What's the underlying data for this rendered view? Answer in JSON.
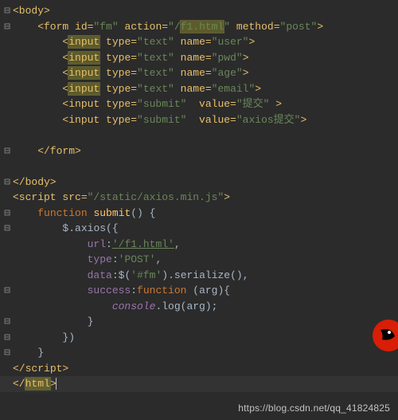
{
  "code": {
    "l1": "<body>",
    "l2a": "    <form id=",
    "l2b": "\"fm\"",
    "l2c": " action=",
    "l2d": "\"/",
    "l2e": "f1.html",
    "l2f": "\"",
    "l2g": " method=",
    "l2h": "\"post\"",
    "l2i": ">",
    "l3a": "        <",
    "l3b": "input",
    "l3c": " type=",
    "l3d": "\"text\"",
    "l3e": " name=",
    "l3f": "\"user\"",
    "l3g": ">",
    "l4a": "        <",
    "l4b": "input",
    "l4c": " type=",
    "l4d": "\"text\"",
    "l4e": " name=",
    "l4f": "\"pwd\"",
    "l4g": ">",
    "l5a": "        <",
    "l5b": "input",
    "l5c": " type=",
    "l5d": "\"text\"",
    "l5e": " name=",
    "l5f": "\"age\"",
    "l5g": ">",
    "l6a": "        <",
    "l6b": "input",
    "l6c": " type=",
    "l6d": "\"text\"",
    "l6e": " name=",
    "l6f": "\"email\"",
    "l6g": ">",
    "l7a": "        <input type=",
    "l7b": "\"submit\"",
    "l7c": "  value=",
    "l7d": "\"提交\"",
    "l7e": " >",
    "l8a": "        <input type=",
    "l8b": "\"submit\"",
    "l8c": "  value=",
    "l8d": "\"axios提交\"",
    "l8e": ">",
    "l9": "",
    "l10": "    </form>",
    "l11": "",
    "l12": "</body>",
    "l13a": "<script src=",
    "l13b": "\"/static/axios.min.js\"",
    "l13c": ">",
    "l14a": "    ",
    "l14b": "function ",
    "l14c": "submit",
    "l14d": "() {",
    "l15a": "        ",
    "l15b": "$",
    "l15c": ".axios({",
    "l16a": "            ",
    "l16b": "url",
    "l16c": ":",
    "l16d": "'/f1.html'",
    "l16e": ",",
    "l17a": "            ",
    "l17b": "type",
    "l17c": ":",
    "l17d": "'POST'",
    "l17e": ",",
    "l18a": "            ",
    "l18b": "data",
    "l18c": ":",
    "l18d": "$",
    "l18e": "(",
    "l18f": "'#fm'",
    "l18g": ").serialize(),",
    "l19a": "            ",
    "l19b": "success",
    "l19c": ":",
    "l19d": "function ",
    "l19e": "(arg){",
    "l20a": "                ",
    "l20b": "console",
    "l20c": ".log(arg);",
    "l21": "            }",
    "l22": "        })",
    "l23": "    }",
    "l24a": "</",
    "l24b": "script",
    "l24c": ">",
    "l25a": "</",
    "l25b": "html",
    "l25c": ">"
  },
  "watermark": "https://blog.csdn.net/qq_41824825"
}
